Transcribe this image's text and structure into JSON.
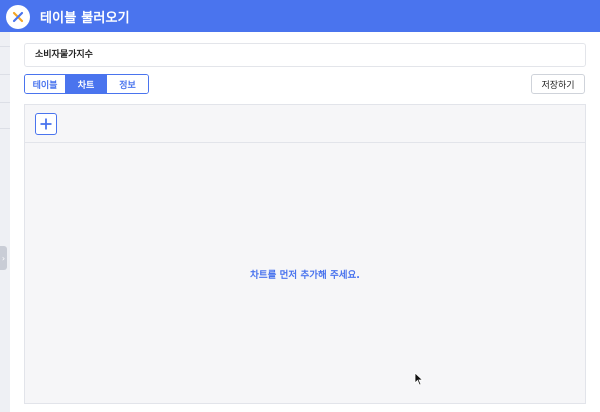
{
  "header": {
    "title": "테이블 불러오기",
    "close_icon": "close-x-icon",
    "accent_color": "#4a74ee"
  },
  "table_name": {
    "value": "소비자물가지수"
  },
  "tabs": [
    {
      "label": "테이블",
      "active": false
    },
    {
      "label": "차트",
      "active": true
    },
    {
      "label": "정보",
      "active": false
    }
  ],
  "toolbar": {
    "save_label": "저장하기",
    "add_icon": "plus-icon"
  },
  "chart_panel": {
    "empty_message": "차트를 먼저 추가해 주세요."
  }
}
